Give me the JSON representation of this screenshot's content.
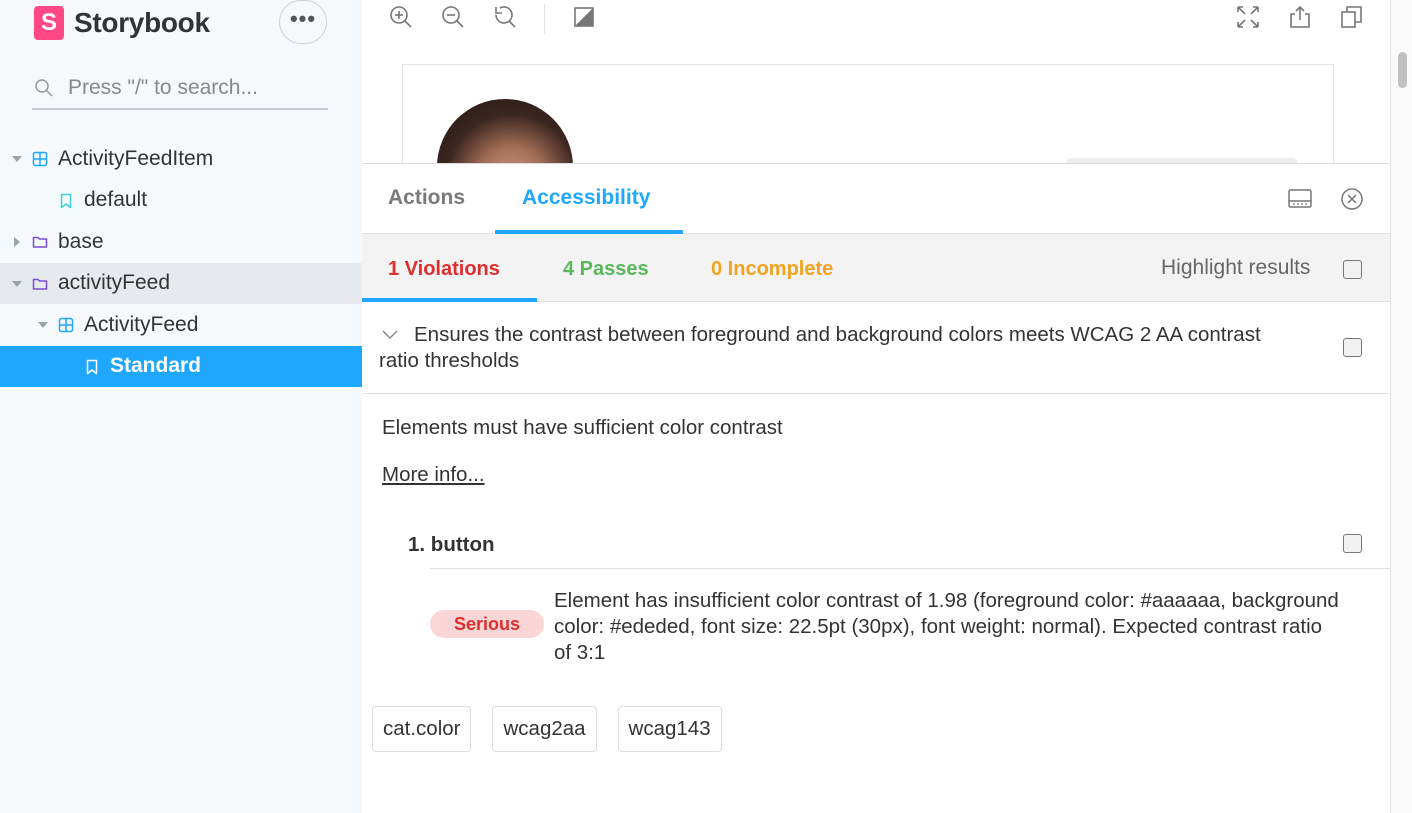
{
  "sidebar": {
    "brand": {
      "logo": "S",
      "name": "Storybook"
    },
    "menu_label": "•••",
    "search": {
      "placeholder": "Press \"/\" to search..."
    },
    "tree": [
      {
        "label": "ActivityFeedItem",
        "type": "component",
        "expanded": true
      },
      {
        "label": "default",
        "type": "story"
      },
      {
        "label": "base",
        "type": "folder",
        "expanded": false
      },
      {
        "label": "activityFeed",
        "type": "folder",
        "expanded": true
      },
      {
        "label": "ActivityFeed",
        "type": "component",
        "expanded": true
      },
      {
        "label": "Standard",
        "type": "story",
        "selected": true
      }
    ]
  },
  "toolbar": {
    "icons": [
      "zoom-in-icon",
      "zoom-out-icon",
      "zoom-reset-icon",
      "background-icon",
      "fullscreen-icon",
      "share-icon",
      "copy-icon"
    ]
  },
  "panel": {
    "tabs": [
      {
        "label": "Actions",
        "active": false
      },
      {
        "label": "Accessibility",
        "active": true
      }
    ],
    "subtabs": [
      {
        "label": "1 Violations",
        "color": "#e02d2d",
        "active": true
      },
      {
        "label": "4 Passes",
        "color": "#59b85c",
        "active": false
      },
      {
        "label": "0 Incomplete",
        "color": "#f2a31f",
        "active": false
      }
    ],
    "highlight_label": "Highlight results",
    "rule": {
      "title": "Ensures the contrast between foreground and background colors meets WCAG 2 AA contrast ratio thresholds",
      "help": "Elements must have sufficient color contrast",
      "more_info": "More info...",
      "element": {
        "title": "1. button",
        "impact": "Serious",
        "message": "Element has insufficient color contrast of 1.98 (foreground color: #aaaaaa, background color: #ededed, font size: 22.5pt (30px), font weight: normal). Expected contrast ratio of 3:1"
      },
      "tags": [
        "cat.color",
        "wcag2aa",
        "wcag143"
      ]
    }
  },
  "colors": {
    "accent": "#1ea7fd",
    "brand": "#ff4785",
    "violation": "#e02d2d",
    "pass": "#59b85c",
    "incomplete": "#f2a31f"
  }
}
